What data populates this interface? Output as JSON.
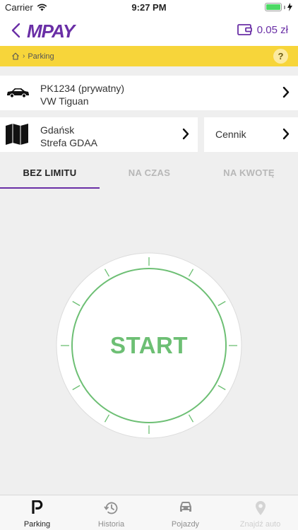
{
  "status": {
    "carrier": "Carrier",
    "time": "9:27 PM"
  },
  "header": {
    "logo": "MPAY",
    "balance": "0.05 zł"
  },
  "breadcrumb": {
    "current": "Parking",
    "help": "?"
  },
  "vehicle": {
    "plate": "PK1234 (prywatny)",
    "model": "VW Tiguan"
  },
  "zone": {
    "city": "Gdańsk",
    "name": "Strefa GDAA"
  },
  "tariff": {
    "label": "Cennik"
  },
  "tabs": [
    {
      "label": "BEZ LIMITU",
      "active": true
    },
    {
      "label": "NA CZAS",
      "active": false
    },
    {
      "label": "NA KWOTĘ",
      "active": false
    }
  ],
  "start": {
    "label": "START"
  },
  "tabbar": [
    {
      "label": "Parking",
      "icon": "parking-icon",
      "state": "active"
    },
    {
      "label": "Historia",
      "icon": "history-icon",
      "state": "normal"
    },
    {
      "label": "Pojazdy",
      "icon": "car-icon",
      "state": "normal"
    },
    {
      "label": "Znajdź auto",
      "icon": "location-pin-icon",
      "state": "disabled"
    }
  ],
  "colors": {
    "brand": "#6a2fa6",
    "accent_bar": "#f7d53a",
    "start_green": "#6dbf74"
  }
}
